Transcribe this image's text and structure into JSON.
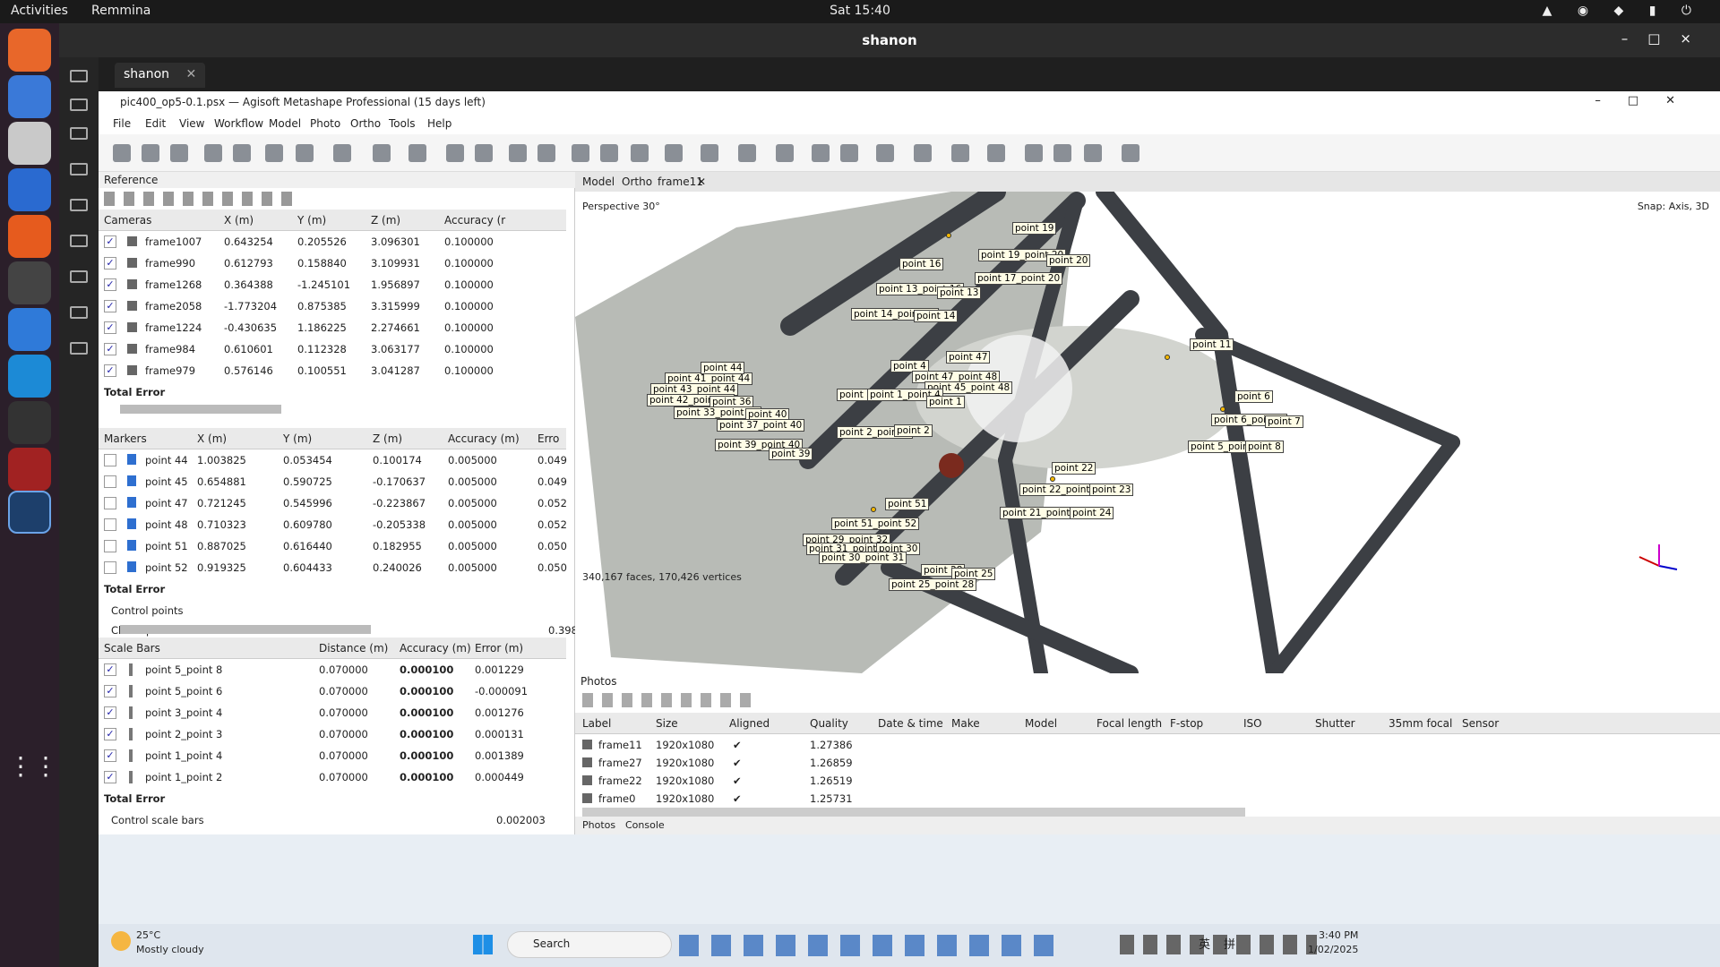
{
  "ubuntu": {
    "activities": "Activities",
    "app": "Remmina",
    "clock": "Sat 15:40"
  },
  "remmina": {
    "window_title": "shanon",
    "tab": "shanon"
  },
  "app": {
    "title": "pic400_op5-0.1.psx — Agisoft Metashape Professional (15 days left)",
    "menu": [
      "File",
      "Edit",
      "View",
      "Workflow",
      "Model",
      "Photo",
      "Ortho",
      "Tools",
      "Help"
    ]
  },
  "reference": {
    "title": "Reference",
    "cameras": {
      "headers": [
        "Cameras",
        "X (m)",
        "Y (m)",
        "Z (m)",
        "Accuracy (r"
      ],
      "rows": [
        [
          "frame1007",
          "0.643254",
          "0.205526",
          "3.096301",
          "0.100000"
        ],
        [
          "frame990",
          "0.612793",
          "0.158840",
          "3.109931",
          "0.100000"
        ],
        [
          "frame1268",
          "0.364388",
          "-1.245101",
          "1.956897",
          "0.100000"
        ],
        [
          "frame2058",
          "-1.773204",
          "0.875385",
          "3.315999",
          "0.100000"
        ],
        [
          "frame1224",
          "-0.430635",
          "1.186225",
          "2.274661",
          "0.100000"
        ],
        [
          "frame984",
          "0.610601",
          "0.112328",
          "3.063177",
          "0.100000"
        ],
        [
          "frame979",
          "0.576146",
          "0.100551",
          "3.041287",
          "0.100000"
        ]
      ],
      "total": "Total Error"
    },
    "markers": {
      "headers": [
        "Markers",
        "X (m)",
        "Y (m)",
        "Z (m)",
        "Accuracy (m)",
        "Erro"
      ],
      "rows": [
        [
          "point 44",
          "1.003825",
          "0.053454",
          "0.100174",
          "0.005000",
          "0.049"
        ],
        [
          "point 45",
          "0.654881",
          "0.590725",
          "-0.170637",
          "0.005000",
          "0.049"
        ],
        [
          "point 47",
          "0.721245",
          "0.545996",
          "-0.223867",
          "0.005000",
          "0.052"
        ],
        [
          "point 48",
          "0.710323",
          "0.609780",
          "-0.205338",
          "0.005000",
          "0.052"
        ],
        [
          "point 51",
          "0.887025",
          "0.616440",
          "0.182955",
          "0.005000",
          "0.050"
        ],
        [
          "point 52",
          "0.919325",
          "0.604433",
          "0.240026",
          "0.005000",
          "0.050"
        ]
      ],
      "total": "Total Error",
      "control": "Control points",
      "check": "Check points",
      "check_val": "0.398"
    },
    "scalebars": {
      "headers": [
        "Scale Bars",
        "Distance (m)",
        "Accuracy (m)",
        "Error (m)"
      ],
      "rows": [
        [
          "point 5_point 8",
          "0.070000",
          "0.000100",
          "0.001229"
        ],
        [
          "point 5_point 6",
          "0.070000",
          "0.000100",
          "-0.000091"
        ],
        [
          "point 3_point 4",
          "0.070000",
          "0.000100",
          "0.001276"
        ],
        [
          "point 2_point 3",
          "0.070000",
          "0.000100",
          "0.000131"
        ],
        [
          "point 1_point 4",
          "0.070000",
          "0.000100",
          "0.001389"
        ],
        [
          "point 1_point 2",
          "0.070000",
          "0.000100",
          "0.000449"
        ]
      ],
      "total": "Total Error",
      "control": "Control scale bars",
      "control_val": "0.002003"
    }
  },
  "viewport": {
    "tabs": [
      "Model",
      "Ortho",
      "frame11"
    ],
    "perspective": "Perspective 30°",
    "snap": "Snap: Axis, 3D",
    "stats": "340,167 faces, 170,426 vertices",
    "markers": [
      "point 19",
      "point 16",
      "point 19_point 20",
      "point 20",
      "point 13_point 16",
      "point 13",
      "point 17_point 20",
      "point 14_point 15",
      "point 14",
      "point 11",
      "point 4",
      "point 47",
      "point 47_point 48",
      "point 45_point 48",
      "point 41_point 44",
      "point 43_point 44",
      "point 42_point 43",
      "point 44",
      "point 36",
      "point 33_point 36",
      "point 3",
      "point 1_point 4",
      "point 1",
      "point 40",
      "point 37_point 40",
      "point 2_point 3",
      "point 2",
      "point 39_point 40",
      "point 39",
      "point 6",
      "point 6_point 7",
      "point 7",
      "point 5_point 8",
      "point 8",
      "point 22",
      "point 22_point 23",
      "point 23",
      "point 21_point 24",
      "point 24",
      "point 51",
      "point 51_point 52",
      "point 29_point 32",
      "point 31_point 32",
      "point 30",
      "point 30_point 31",
      "point 28",
      "point 25",
      "point 25_point 28"
    ]
  },
  "photos": {
    "title": "Photos",
    "headers": [
      "Label",
      "Size",
      "Aligned",
      "Quality",
      "Date & time",
      "Make",
      "Model",
      "Focal length",
      "F-stop",
      "ISO",
      "Shutter",
      "35mm focal",
      "Sensor"
    ],
    "rows": [
      [
        "frame11",
        "1920x1080",
        "1.27386"
      ],
      [
        "frame27",
        "1920x1080",
        "1.26859"
      ],
      [
        "frame22",
        "1920x1080",
        "1.26519"
      ],
      [
        "frame0",
        "1920x1080",
        "1.25731"
      ]
    ],
    "bottom_tabs": [
      "Photos",
      "Console"
    ]
  },
  "taskbar": {
    "temp": "25°C",
    "weather": "Mostly cloudy",
    "search": "Search",
    "time": "3:40 PM",
    "date": "1/02/2025",
    "lang1": "英",
    "lang2": "拼"
  }
}
